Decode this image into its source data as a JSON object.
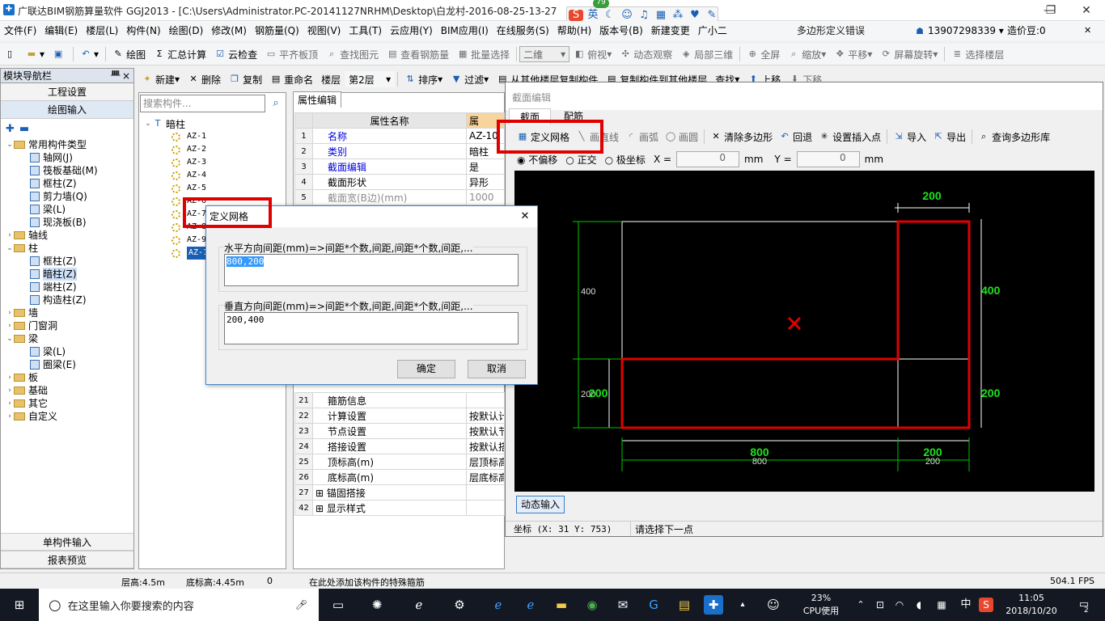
{
  "window": {
    "title": "广联达BIM钢筋算量软件 GGJ2013 - [C:\\Users\\Administrator.PC-20141127NRHM\\Desktop\\白龙村-2016-08-25-13-27",
    "min": "—",
    "max": "❐",
    "close": "✕"
  },
  "ime": {
    "logo": "S",
    "lang": "英",
    "badge": "79"
  },
  "menu": {
    "items": [
      "文件(F)",
      "编辑(E)",
      "楼层(L)",
      "构件(N)",
      "绘图(D)",
      "修改(M)",
      "钢筋量(Q)",
      "视图(V)",
      "工具(T)",
      "云应用(Y)",
      "BIM应用(I)",
      "在线服务(S)",
      "帮助(H)",
      "版本号(B)",
      "新建变更",
      "广小二"
    ],
    "error_text": "多边形定义错误",
    "phone": "13907298339",
    "price": "造价豆:0"
  },
  "toolbar1": {
    "draw": "绘图",
    "sum": "汇总计算",
    "cloud": "云检查",
    "flat": "平齐板顶",
    "find": "查找图元",
    "view_rebar": "查看钢筋量",
    "batch": "批量选择",
    "mode": "二维",
    "top": "俯视",
    "orbit": "动态观察",
    "local3d": "局部三维",
    "full": "全屏",
    "zoom": "缩放",
    "pan": "平移",
    "rotate": "屏幕旋转",
    "select_floor": "选择楼层"
  },
  "toolbar2": {
    "new": "新建",
    "delete": "删除",
    "copy": "复制",
    "rename": "重命名",
    "floor_label": "楼层",
    "floor_value": "第2层",
    "sort": "排序",
    "filter": "过滤",
    "copy_from": "从其他楼层复制构件",
    "copy_to": "复制构件到其他楼层",
    "find": "查找",
    "up": "上移",
    "down": "下移"
  },
  "leftnav": {
    "header": "模块导航栏",
    "pin": "ᚙ",
    "close": "×",
    "project_settings": "工程设置",
    "drawing_input": "绘图输入",
    "tree": [
      {
        "label": "常用构件类型",
        "level": 0,
        "type": "folder",
        "exp": "⌄"
      },
      {
        "label": "轴网(J)",
        "level": 1,
        "type": "comp"
      },
      {
        "label": "筏板基础(M)",
        "level": 1,
        "type": "comp"
      },
      {
        "label": "框柱(Z)",
        "level": 1,
        "type": "comp"
      },
      {
        "label": "剪力墙(Q)",
        "level": 1,
        "type": "comp"
      },
      {
        "label": "梁(L)",
        "level": 1,
        "type": "comp"
      },
      {
        "label": "现浇板(B)",
        "level": 1,
        "type": "comp"
      },
      {
        "label": "轴线",
        "level": 0,
        "type": "folder",
        "exp": "›"
      },
      {
        "label": "柱",
        "level": 0,
        "type": "folder",
        "exp": "⌄"
      },
      {
        "label": "框柱(Z)",
        "level": 1,
        "type": "comp"
      },
      {
        "label": "暗柱(Z)",
        "level": 1,
        "type": "comp",
        "selected": true
      },
      {
        "label": "端柱(Z)",
        "level": 1,
        "type": "comp"
      },
      {
        "label": "构造柱(Z)",
        "level": 1,
        "type": "comp"
      },
      {
        "label": "墙",
        "level": 0,
        "type": "folder",
        "exp": "›"
      },
      {
        "label": "门窗洞",
        "level": 0,
        "type": "folder",
        "exp": "›"
      },
      {
        "label": "梁",
        "level": 0,
        "type": "folder",
        "exp": "⌄"
      },
      {
        "label": "梁(L)",
        "level": 1,
        "type": "comp"
      },
      {
        "label": "圈梁(E)",
        "level": 1,
        "type": "comp"
      },
      {
        "label": "板",
        "level": 0,
        "type": "folder",
        "exp": "›"
      },
      {
        "label": "基础",
        "level": 0,
        "type": "folder",
        "exp": "›"
      },
      {
        "label": "其它",
        "level": 0,
        "type": "folder",
        "exp": "›"
      },
      {
        "label": "自定义",
        "level": 0,
        "type": "folder",
        "exp": "›"
      }
    ],
    "single_input": "单构件输入",
    "report": "报表预览"
  },
  "complist": {
    "search_placeholder": "搜索构件...",
    "root": "暗柱",
    "items": [
      "AZ-1",
      "AZ-2",
      "AZ-3",
      "AZ-4",
      "AZ-5",
      "AZ-6",
      "AZ-7",
      "AZ-8",
      "AZ-9",
      "AZ-10"
    ]
  },
  "props": {
    "tab": "属性编辑",
    "col_name": "属性名称",
    "col_value": "属",
    "rows_top": [
      {
        "n": "1",
        "name": "名称",
        "val": "AZ-10",
        "blue": true
      },
      {
        "n": "2",
        "name": "类别",
        "val": "暗柱",
        "blue": true
      },
      {
        "n": "3",
        "name": "截面编辑",
        "val": "是",
        "blue": true
      },
      {
        "n": "4",
        "name": "截面形状",
        "val": "异形",
        "blue": false
      },
      {
        "n": "5",
        "name": "截面宽(B边)(mm)",
        "val": "1000",
        "blue": false,
        "gray": true
      }
    ],
    "rows_bottom": [
      {
        "n": "21",
        "name": "箍筋信息",
        "val": ""
      },
      {
        "n": "22",
        "name": "计算设置",
        "val": "按默认计"
      },
      {
        "n": "23",
        "name": "节点设置",
        "val": "按默认节"
      },
      {
        "n": "24",
        "name": "搭接设置",
        "val": "按默认搭"
      },
      {
        "n": "25",
        "name": "顶标高(m)",
        "val": "层顶标高"
      },
      {
        "n": "26",
        "name": "底标高(m)",
        "val": "层底标高"
      },
      {
        "n": "27",
        "name": "锚固搭接",
        "val": "",
        "plus": true
      },
      {
        "n": "42",
        "name": "显示样式",
        "val": "",
        "plus": true
      }
    ]
  },
  "section_editor": {
    "title": "截面编辑",
    "tabs": [
      "截面",
      "配筋"
    ],
    "tools": {
      "grid": "定义网格",
      "line": "画直线",
      "arc": "画弧",
      "circle": "画圆",
      "clear": "清除多边形",
      "undo": "回退",
      "insert": "设置插入点",
      "import": "导入",
      "export": "导出",
      "query": "查询多边形库"
    },
    "offset": {
      "none": "不偏移",
      "ortho": "正交",
      "polar": "极坐标",
      "x_label": "X =",
      "x_value": "0",
      "y_label": "Y =",
      "y_value": "0",
      "unit": "mm"
    },
    "canvas": {
      "dims_top": [
        "200"
      ],
      "dims_left": [
        "400",
        "200",
        "200"
      ],
      "dims_right": [
        "400",
        "200"
      ],
      "dims_bottom": [
        "800",
        "800",
        "200",
        "200"
      ]
    },
    "dynamic_input": "动态输入",
    "coord": "坐标 (X: 31 Y: 753)",
    "prompt": "请选择下一点"
  },
  "dialog": {
    "title": "定义网格",
    "close": "✕",
    "h_label": "水平方向间距(mm)=>间距*个数,间距,间距*个数,间距,...",
    "h_value": "800,200",
    "v_label": "垂直方向间距(mm)=>间距*个数,间距,间距*个数,间距,...",
    "v_value": "200,400",
    "ok": "确定",
    "cancel": "取消"
  },
  "highlights": {
    "color": "#e00000"
  },
  "status": {
    "floor_height": "层高:4.5m",
    "base_height": "底标高:4.45m",
    "zero": "0",
    "hint": "在此处添加该构件的特殊箍筋",
    "fps": "504.1 FPS"
  },
  "taskbar": {
    "search": "在这里输入你要搜索的内容",
    "cpu_percent": "23%",
    "cpu_label": "CPU使用",
    "time": "11:05",
    "date": "2018/10/20",
    "lang": "中",
    "notify": "2"
  }
}
